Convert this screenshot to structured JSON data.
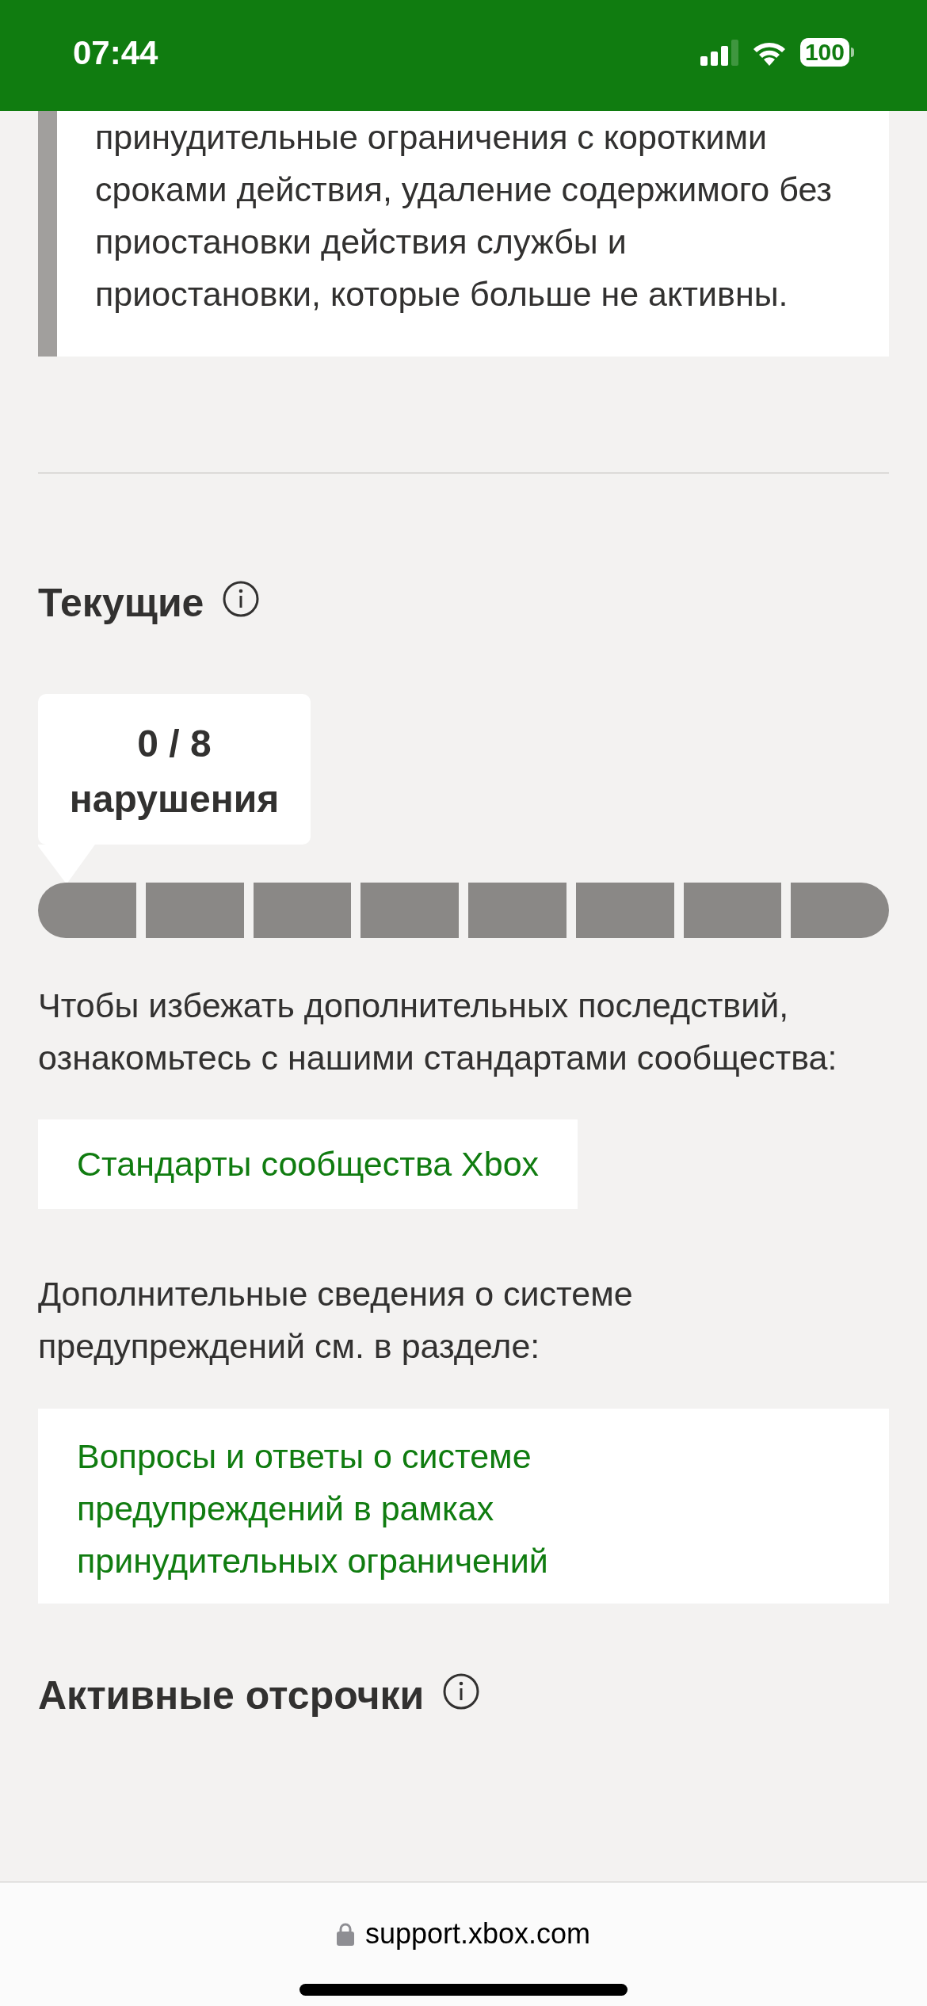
{
  "status_bar": {
    "time": "07:44",
    "battery": "100"
  },
  "notice_card": {
    "text": "принудительные ограничения с короткими сроками действия, удаление содержимого без приостановки действия службы и приостановки, которые больше не активны."
  },
  "current": {
    "heading": "Текущие",
    "tooltip": {
      "count": "0 / 8",
      "unit": "нарушения"
    },
    "segments": [
      {
        "filled": false
      },
      {
        "filled": false
      },
      {
        "filled": false
      },
      {
        "filled": false
      },
      {
        "filled": false
      },
      {
        "filled": false
      },
      {
        "filled": false
      },
      {
        "filled": false
      }
    ],
    "standards_text": "Чтобы избежать дополнительных последствий, ознакомьтесь с нашими стандартами сообщества:",
    "standards_link": "Стандарты сообщества Xbox",
    "faq_text": "Дополнительные сведения о системе предупреждений см. в разделе:",
    "faq_link": "Вопросы и ответы о системе предупреждений в рамках принудительных ограничений"
  },
  "active_deferrals": {
    "heading": "Активные отсрочки"
  },
  "browser_bar": {
    "url": "support.xbox.com"
  }
}
